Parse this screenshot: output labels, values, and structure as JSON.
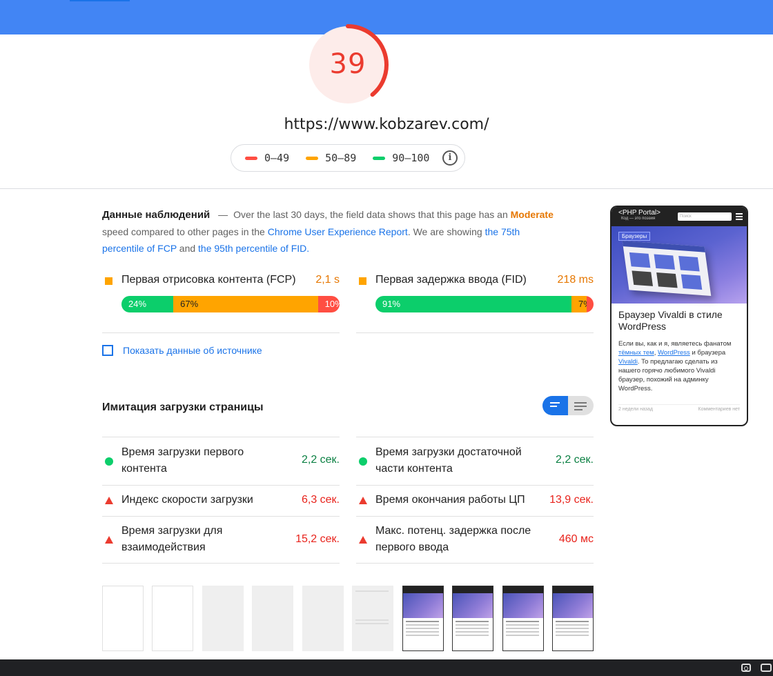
{
  "score": {
    "value": "39",
    "fraction": 0.39,
    "color": "#eb3b2f"
  },
  "url": "https://www.kobzarev.com/",
  "legend": {
    "items": [
      {
        "label": "0–49",
        "color": "#ff4e42"
      },
      {
        "label": "50–89",
        "color": "#ffa400"
      },
      {
        "label": "90–100",
        "color": "#0cce6b"
      }
    ],
    "info_icon": "info-icon"
  },
  "field": {
    "title": "Данные наблюдений",
    "dash": "—",
    "text1": "Over the last 30 days, the field data shows that this page has an",
    "moderate": "Moderate",
    "text2": "speed compared to other pages in the",
    "crux_link": "Chrome User Experience Report",
    "text3": ". We are showing",
    "fcp_link": "the 75th percentile of FCP",
    "and": "and",
    "fid_link": "the 95th percentile of FID",
    "period": "."
  },
  "field_metrics": [
    {
      "title": "Первая отрисовка контента (FCP)",
      "value": "2,1 s",
      "distribution": [
        {
          "label": "24%",
          "share": 24,
          "kind": "good"
        },
        {
          "label": "67%",
          "share": 67,
          "kind": "average"
        },
        {
          "label": "10%",
          "share": 10,
          "kind": "poor"
        }
      ]
    },
    {
      "title": "Первая задержка ввода (FID)",
      "value": "218 ms",
      "distribution": [
        {
          "label": "91%",
          "share": 91,
          "kind": "good"
        },
        {
          "label": "7%",
          "share": 7,
          "kind": "average"
        },
        {
          "label": "2%",
          "share": 2,
          "kind": "poor"
        }
      ]
    }
  ],
  "show_origin": "Показать данные об источнике",
  "lab": {
    "title": "Имитация загрузки страницы",
    "metrics": [
      {
        "title": "Время загрузки первого контента",
        "value": "2,2 сек.",
        "status": "good"
      },
      {
        "title": "Время загрузки достаточной части контента",
        "value": "2,2 сек.",
        "status": "good"
      },
      {
        "title": "Индекс скорости загрузки",
        "value": "6,3 сек.",
        "status": "bad"
      },
      {
        "title": "Время окончания работы ЦП",
        "value": "13,9 сек.",
        "status": "bad"
      },
      {
        "title": "Время загрузки для взаимодействия",
        "value": "15,2 сек.",
        "status": "bad"
      },
      {
        "title": "Макс. потенц. задержка после первого ввода",
        "value": "460 мс",
        "status": "bad"
      }
    ]
  },
  "preview": {
    "logo": "<PHP Portal>",
    "sub": "Код — это поэзия",
    "search_placeholder": "Поиск",
    "tag": "Браузеры",
    "title": "Браузер Vivaldi в стиле WordPress",
    "text_a": "Если вы, как и я, являетесь фанатом",
    "link_a": "тёмных тем",
    "text_b": ",",
    "link_b": "WordPress",
    "text_c": "и браузера",
    "link_c": "Vivaldi",
    "text_d": ". То предлагаю сделать из нашего горячо любимого Vivaldi браузер, похожий на админку WordPress.",
    "date": "2 недели назад",
    "comments": "Комментариев нет"
  },
  "filmstrip": [
    "blank",
    "blank",
    "gray",
    "gray",
    "gray",
    "gray-faded",
    "shot",
    "shot",
    "shot",
    "shot"
  ]
}
